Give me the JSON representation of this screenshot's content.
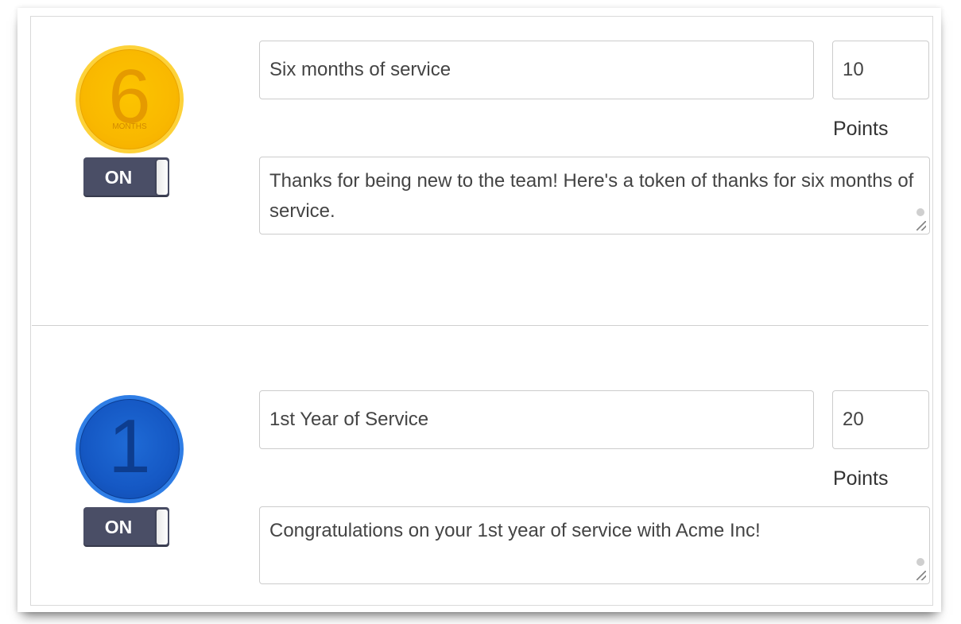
{
  "awards": [
    {
      "badge": {
        "icon": "six-months-badge-icon",
        "number": "6",
        "sub": "MONTHS",
        "color": "#f9b800"
      },
      "toggle_label": "ON",
      "title": "Six months of service",
      "points": "10",
      "points_label": "Points",
      "message": "Thanks for being new to the team! Here's a token of thanks for six months of service."
    },
    {
      "badge": {
        "icon": "one-year-badge-icon",
        "number": "1",
        "color": "#1558c4"
      },
      "toggle_label": "ON",
      "title": "1st Year of Service",
      "points": "20",
      "points_label": "Points",
      "message": "Congratulations on your 1st year of service with Acme Inc!"
    }
  ],
  "colors": {
    "toggle_bg": "#4a4e66",
    "gold_badge": "#f9b800",
    "blue_badge": "#1558c4",
    "border": "#cccccc"
  }
}
